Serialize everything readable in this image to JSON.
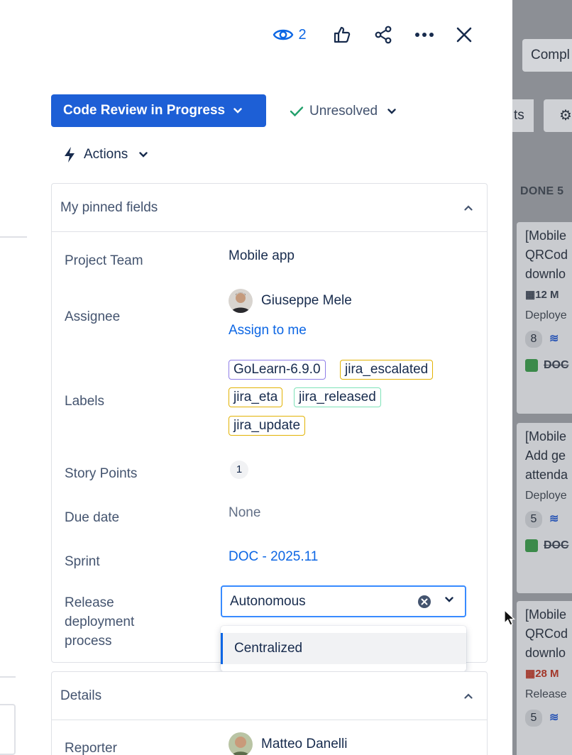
{
  "toolbar": {
    "watch_count": "2",
    "watch_icon": "eye-icon",
    "like_icon": "thumbs-up-icon",
    "share_icon": "share-icon",
    "more_icon": "more-icon",
    "close_icon": "close-icon"
  },
  "status": {
    "label": "Code Review in Progress",
    "resolution": "Unresolved",
    "actions_label": "Actions",
    "accent": "#1d5fd6"
  },
  "pinned": {
    "title": "My pinned fields",
    "fields": {
      "project_team": {
        "label": "Project Team",
        "value": "Mobile app"
      },
      "assignee": {
        "label": "Assignee",
        "name": "Giuseppe Mele",
        "assign_link": "Assign to me"
      },
      "labels": {
        "label": "Labels",
        "chips": [
          "GoLearn-6.9.0",
          "jira_escalated",
          "jira_eta",
          "jira_released",
          "jira_update"
        ]
      },
      "story_points": {
        "label": "Story Points",
        "value": "1"
      },
      "due_date": {
        "label": "Due date",
        "value": "None"
      },
      "sprint": {
        "label": "Sprint",
        "value": "DOC - 2025.11"
      },
      "release": {
        "label_line1": "Release",
        "label_line2": "deployment",
        "label_line3": "process",
        "value": "Autonomous",
        "options": [
          "Centralized"
        ]
      }
    }
  },
  "details": {
    "title": "Details",
    "reporter_label": "Reporter",
    "reporter_name": "Matteo Danelli"
  },
  "board": {
    "complete_button": "Compl",
    "tab_fragment": "ts",
    "column": "DONE 5",
    "cards": [
      {
        "line1": "[Mobile",
        "line2": "QRCod",
        "line3": "downlo",
        "date": "12 M",
        "status": "Deploye",
        "points": "8",
        "doc": "DOC"
      },
      {
        "line1": "[Mobile",
        "line2": "Add ge",
        "line3": "attenda",
        "status": "Deploye",
        "points": "5",
        "doc": "DOC"
      },
      {
        "line1": "[Mobile",
        "line2": "QRCod",
        "line3": "downlo",
        "date": "28 M",
        "status": "Release",
        "points": "5"
      }
    ]
  }
}
